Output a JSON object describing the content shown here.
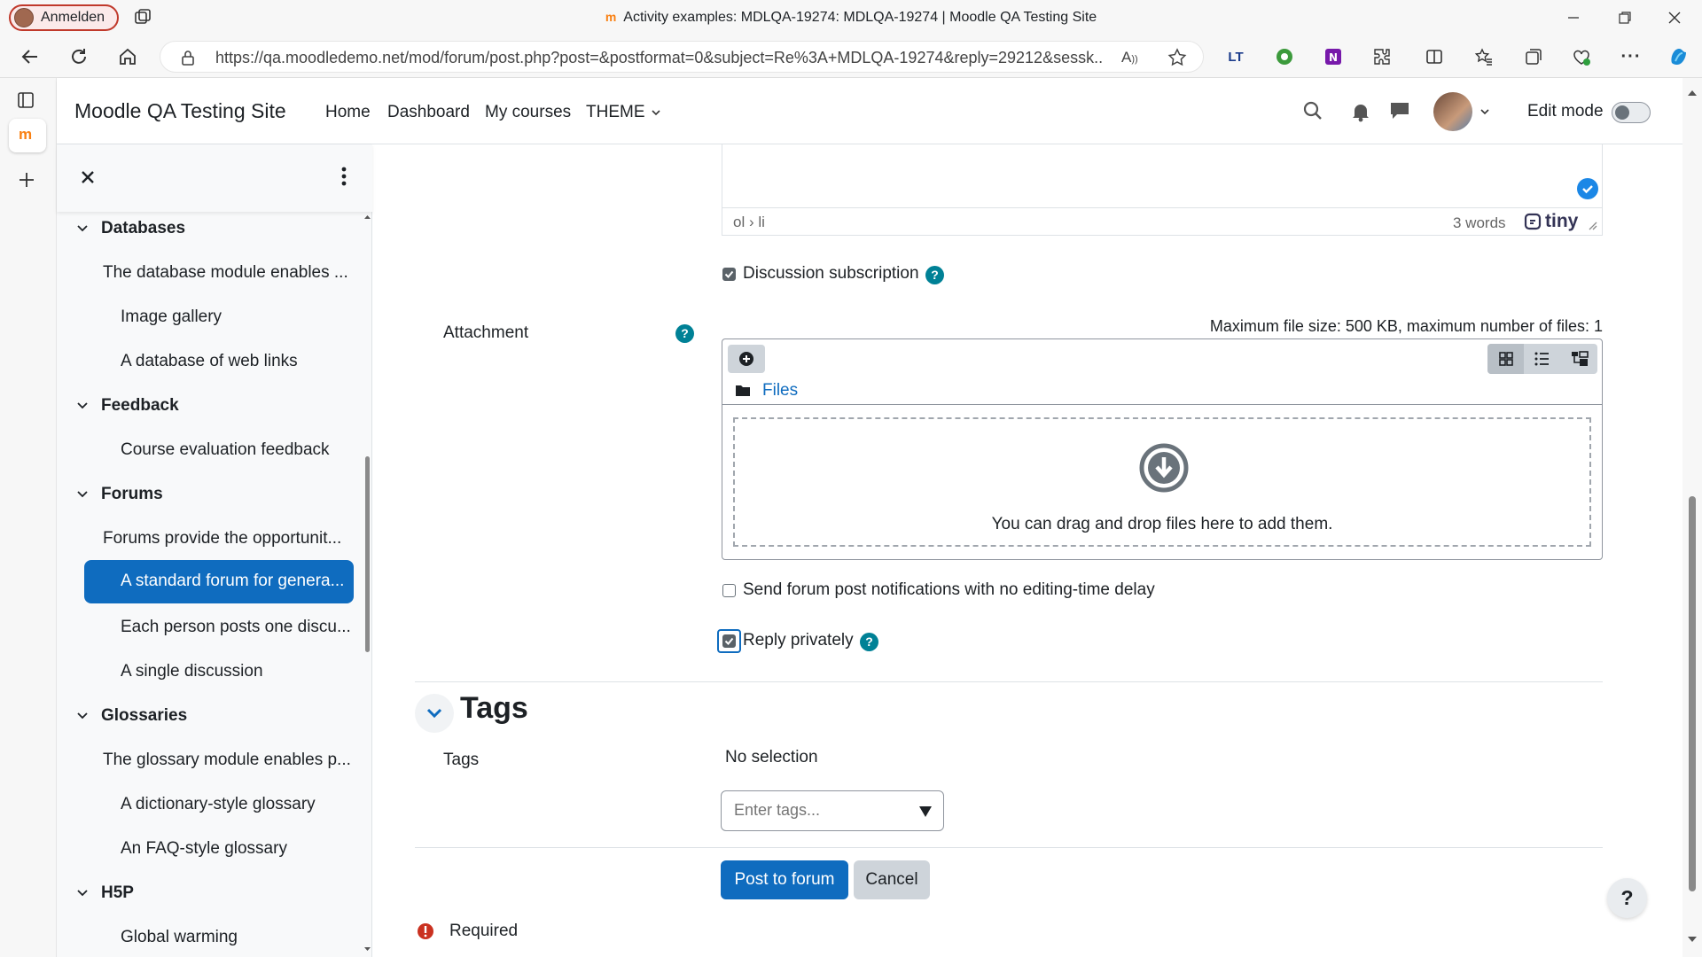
{
  "browser": {
    "profile_label": "Anmelden",
    "window_title": "Activity examples: MDLQA-19274: MDLQA-19274 | Moodle QA Testing Site",
    "url": "https://qa.moodledemo.net/mod/forum/post.php?post=&postformat=0&subject=Re%3A+MDLQA-19274&reply=29212&sessk..."
  },
  "navbar": {
    "site_name": "Moodle QA Testing Site",
    "links": [
      "Home",
      "Dashboard",
      "My courses",
      "THEME"
    ],
    "edit_mode_label": "Edit mode"
  },
  "course_index": {
    "sections": [
      {
        "title": "Databases",
        "items": [
          "The database module enables ...",
          "Image gallery",
          "A database of web links"
        ]
      },
      {
        "title": "Feedback",
        "items": [
          "Course evaluation feedback"
        ]
      },
      {
        "title": "Forums",
        "items": [
          "Forums provide the opportunit...",
          "A standard forum for genera...",
          "Each person posts one discu...",
          "A single discussion"
        ]
      },
      {
        "title": "Glossaries",
        "items": [
          "The glossary module enables p...",
          "A dictionary-style glossary",
          "An FAQ-style glossary"
        ]
      },
      {
        "title": "H5P",
        "items": [
          "Global warming"
        ]
      }
    ]
  },
  "editor": {
    "path": "ol › li",
    "word_count": "3 words",
    "brand": "tiny"
  },
  "form": {
    "discussion_subscription_label": "Discussion subscription",
    "discussion_subscription_checked": true,
    "attachment_label": "Attachment",
    "file_limits": "Maximum file size: 500 KB, maximum number of files: 1",
    "files_folder": "Files",
    "drop_text": "You can drag and drop files here to add them.",
    "no_delay_label": "Send forum post notifications with no editing-time delay",
    "no_delay_checked": false,
    "reply_privately_label": "Reply privately",
    "reply_privately_checked": true,
    "tags_heading": "Tags",
    "tags_label": "Tags",
    "tags_selection": "No selection",
    "tags_placeholder": "Enter tags...",
    "post_button": "Post to forum",
    "cancel_button": "Cancel",
    "required_label": "Required"
  },
  "help_button": "?",
  "colors": {
    "primary": "#0f6cbf",
    "help": "#008196",
    "required": "#ca3120",
    "moodle_orange": "#f98012"
  }
}
